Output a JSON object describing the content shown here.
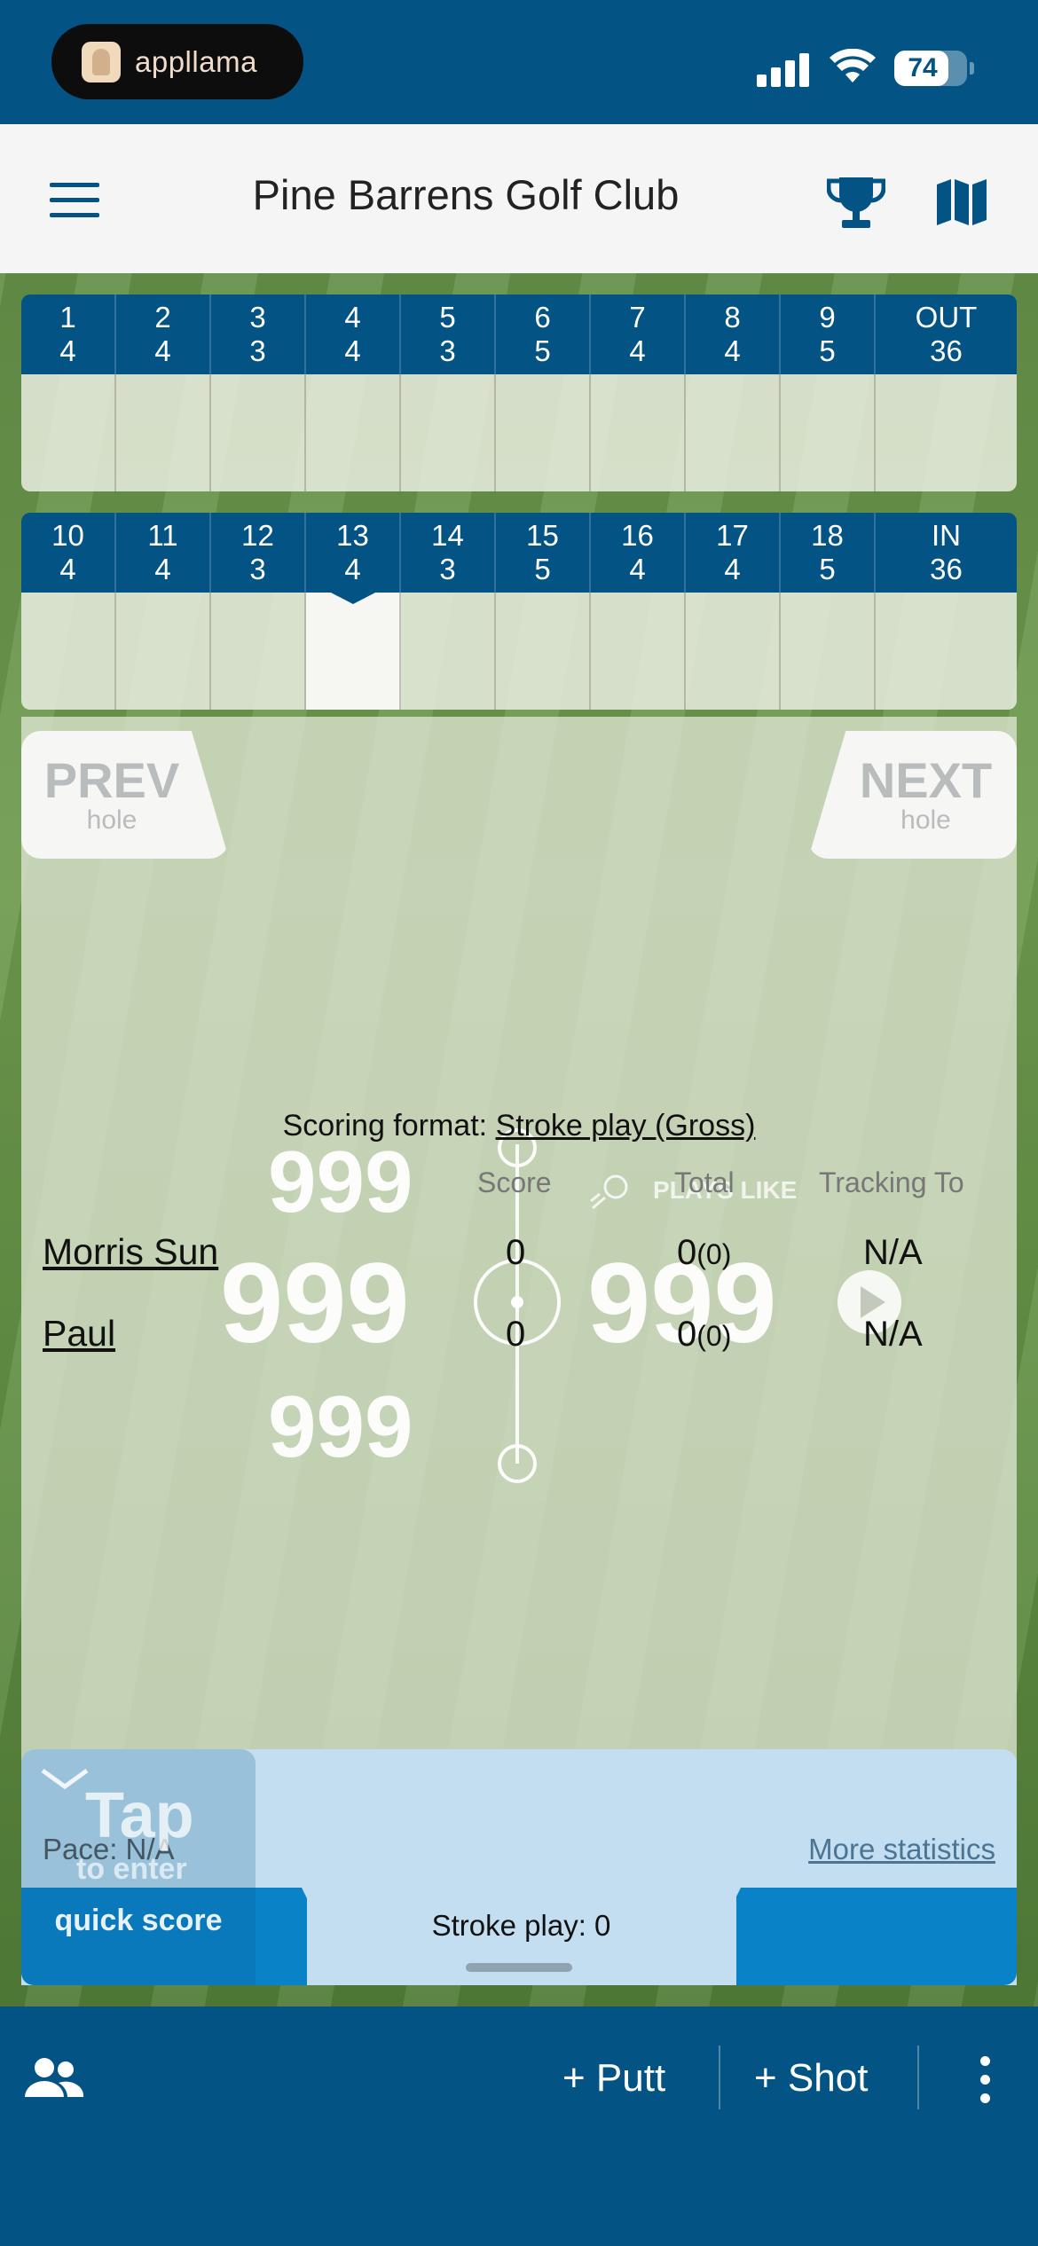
{
  "status_bar": {
    "app_name": "appllama",
    "battery": "74",
    "battery_level": 0.74
  },
  "header": {
    "title": "Pine Barrens Golf Club"
  },
  "scorecard": {
    "front": [
      {
        "hole": "1",
        "par": "4"
      },
      {
        "hole": "2",
        "par": "4"
      },
      {
        "hole": "3",
        "par": "3"
      },
      {
        "hole": "4",
        "par": "4"
      },
      {
        "hole": "5",
        "par": "3"
      },
      {
        "hole": "6",
        "par": "5"
      },
      {
        "hole": "7",
        "par": "4"
      },
      {
        "hole": "8",
        "par": "4"
      },
      {
        "hole": "9",
        "par": "5"
      }
    ],
    "front_total": {
      "label": "OUT",
      "par": "36"
    },
    "back": [
      {
        "hole": "10",
        "par": "4"
      },
      {
        "hole": "11",
        "par": "4"
      },
      {
        "hole": "12",
        "par": "3"
      },
      {
        "hole": "13",
        "par": "4"
      },
      {
        "hole": "14",
        "par": "3"
      },
      {
        "hole": "15",
        "par": "5"
      },
      {
        "hole": "16",
        "par": "4"
      },
      {
        "hole": "17",
        "par": "4"
      },
      {
        "hole": "18",
        "par": "5"
      }
    ],
    "back_total": {
      "label": "IN",
      "par": "36"
    },
    "current_hole": "13"
  },
  "hole_nav": {
    "prev_big": "PREV",
    "prev_small": "hole",
    "next_big": "NEXT",
    "next_small": "hole"
  },
  "distances": {
    "top": "999",
    "middle_left": "999",
    "middle_right": "999",
    "bottom": "999",
    "plays_like": "PLAYS LIKE"
  },
  "scoring": {
    "format_label": "Scoring format:",
    "format_value": "Stroke play (Gross)",
    "columns": {
      "score": "Score",
      "total": "Total",
      "tracking": "Tracking To"
    },
    "players": [
      {
        "name": "Morris Sun",
        "score": "0",
        "total": "0",
        "total_sub": "(0)",
        "tracking": "N/A"
      },
      {
        "name": "Paul",
        "score": "0",
        "total": "0",
        "total_sub": "(0)",
        "tracking": "N/A"
      }
    ]
  },
  "sheet": {
    "pace": "Pace: N/A",
    "more_statistics": "More statistics",
    "stroke_play": "Stroke play: 0"
  },
  "quick_score": {
    "tap": "Tap",
    "to_enter": "to enter",
    "quick_score": "quick score"
  },
  "bottom_bar": {
    "putt_label": "+ Putt",
    "shot_label": "+ Shot"
  },
  "colors": {
    "primary": "#035485",
    "accent": "#0a82c8",
    "sheet": "#c2def0"
  },
  "icons": {
    "menu": "menu-icon",
    "trophy": "trophy-icon",
    "map": "map-icon",
    "people": "people-icon",
    "more": "kebab-icon"
  }
}
